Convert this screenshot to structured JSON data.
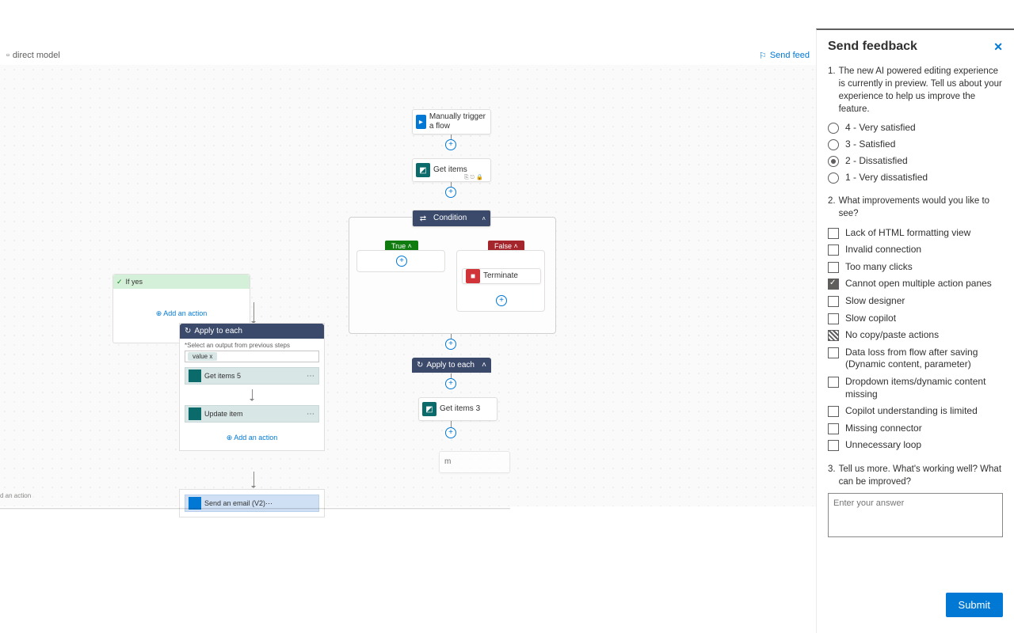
{
  "topbar": {
    "title": "direct model",
    "sendfeed": "Send feed"
  },
  "flow": {
    "trigger": "Manually trigger a flow",
    "getitems": "Get items",
    "condition": "Condition",
    "true": "True",
    "false": "False",
    "terminate": "Terminate",
    "applyeach": "Apply to each",
    "getitems3": "Get items 3",
    "ifyes": "If yes",
    "addaction": "Add an action",
    "applyeach2": "Apply to each",
    "selectoutput": "*Select an output from previous steps",
    "value": "value x",
    "getitems5": "Get items 5",
    "updateitem": "Update item",
    "sendemail": "Send an email (V2)"
  },
  "panel": {
    "title": "Send feedback",
    "q1": "The new AI powered editing experience is currently in preview. Tell us about your experience to help us improve the feature.",
    "q1opts": [
      "4 - Very satisfied",
      "3 - Satisfied",
      "2 - Dissatisfied",
      "1 - Very dissatisfied"
    ],
    "q2": "What improvements would you like to see?",
    "q2opts": [
      "Lack of HTML formatting view",
      "Invalid connection",
      "Too many clicks",
      "Cannot open multiple action panes",
      "Slow designer",
      "Slow copilot",
      "No copy/paste actions",
      "Data loss from flow after saving (Dynamic content, parameter)",
      "Dropdown items/dynamic content missing",
      "Copilot understanding is limited",
      "Missing connector",
      "Unnecessary loop"
    ],
    "q3": "Tell us more. What's working well? What can be improved?",
    "placeholder": "Enter your answer",
    "submit": "Submit"
  }
}
